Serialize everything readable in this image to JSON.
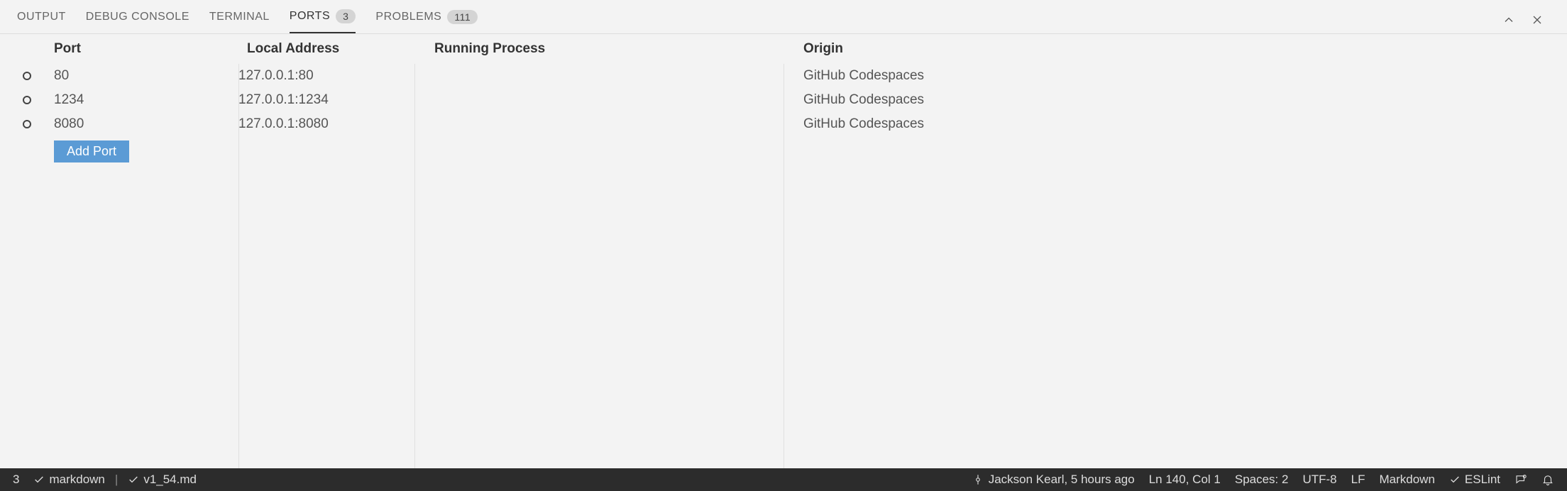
{
  "tabs": {
    "output": "OUTPUT",
    "debug": "DEBUG CONSOLE",
    "terminal": "TERMINAL",
    "ports": "PORTS",
    "ports_count": "3",
    "problems": "PROBLEMS",
    "problems_count": "111"
  },
  "cols": {
    "port": "Port",
    "addr": "Local Address",
    "proc": "Running Process",
    "origin": "Origin"
  },
  "rows": [
    {
      "port": "80",
      "addr": "127.0.0.1:80",
      "proc": "",
      "origin": "GitHub Codespaces"
    },
    {
      "port": "1234",
      "addr": "127.0.0.1:1234",
      "proc": "",
      "origin": "GitHub Codespaces"
    },
    {
      "port": "8080",
      "addr": "127.0.0.1:8080",
      "proc": "",
      "origin": "GitHub Codespaces"
    }
  ],
  "add_port": "Add Port",
  "status": {
    "left_count": "3",
    "lang1": "markdown",
    "lang2": "v1_54.md",
    "blame": "Jackson Kearl, 5 hours ago",
    "cursor": "Ln 140, Col 1",
    "spaces": "Spaces: 2",
    "encoding": "UTF-8",
    "eol": "LF",
    "mode": "Markdown",
    "eslint": "ESLint"
  }
}
